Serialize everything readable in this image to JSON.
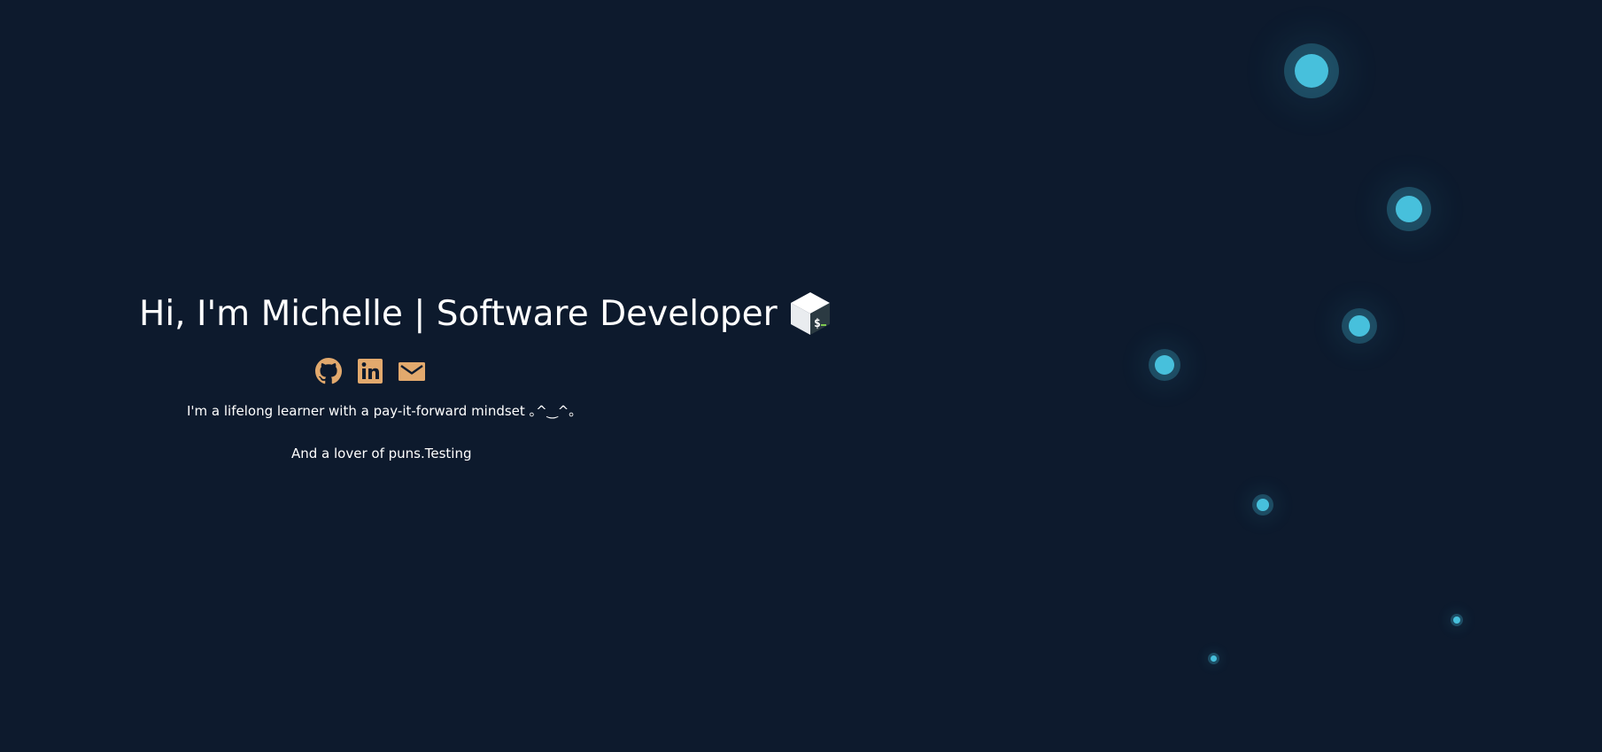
{
  "hero": {
    "title": "Hi, I'm Michelle | Software Developer",
    "tagline": "I'm a lifelong learner with a pay-it-forward mindset ｡^‿^｡",
    "puns": "And a lover of puns.Testing"
  },
  "icons": {
    "title_icon": "bash-terminal-icon",
    "social": [
      "github-icon",
      "linkedin-icon",
      "email-icon"
    ]
  },
  "colors": {
    "background": "#0d1a2d",
    "text": "#ffffff",
    "social_icons": "#e2a96d",
    "bubbles": "#47c0dc"
  }
}
